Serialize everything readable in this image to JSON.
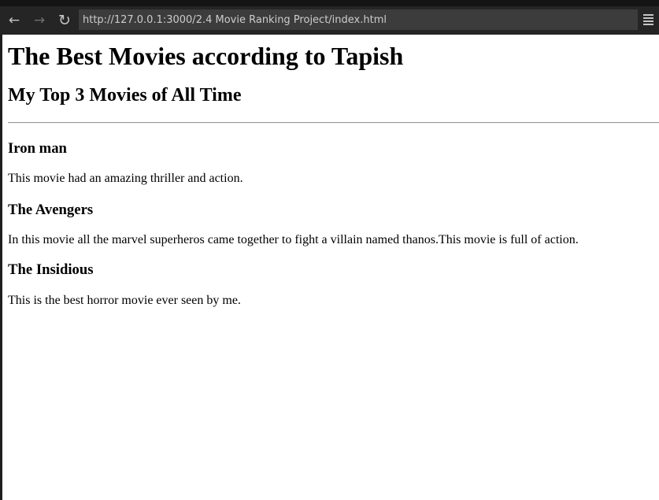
{
  "browser": {
    "url": "http://127.0.0.1:3000/2.4 Movie Ranking Project/index.html",
    "back_icon": "←",
    "forward_icon": "→",
    "reload_icon": "↻"
  },
  "page": {
    "title": "The Best Movies according to Tapish",
    "subtitle": "My Top 3 Movies of All Time",
    "movies": [
      {
        "name": "Iron man",
        "description": "This movie had an amazing thriller and action."
      },
      {
        "name": "The Avengers",
        "description": "In this movie all the marvel superheros came together to fight a villain named thanos.This movie is full of action."
      },
      {
        "name": "The Insidious",
        "description": "This is the best horror movie ever seen by me."
      }
    ]
  }
}
